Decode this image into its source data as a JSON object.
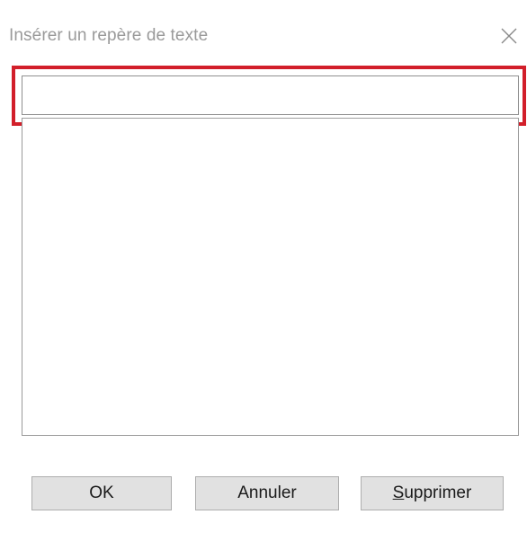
{
  "window": {
    "title": "Insérer un repère de texte",
    "close_icon": "close-icon"
  },
  "bookmark_input": {
    "value": "",
    "placeholder": ""
  },
  "bookmark_list": {
    "items": []
  },
  "buttons": {
    "ok_label": "OK",
    "cancel_label": "Annuler",
    "delete_mnemonic": "S",
    "delete_rest": "upprimer"
  },
  "colors": {
    "highlight": "#d21f2a",
    "button_bg": "#e1e1e1",
    "title_text": "#9a9a9a"
  }
}
